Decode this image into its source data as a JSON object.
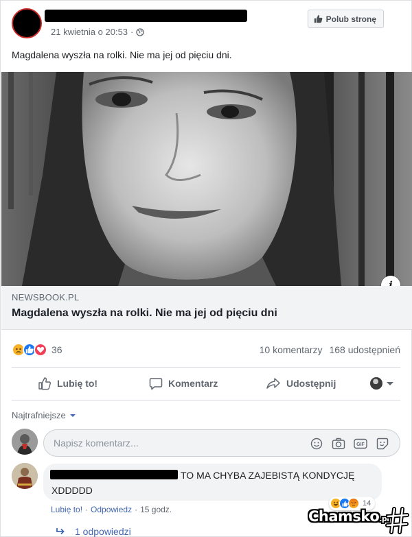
{
  "post": {
    "timestamp": "21 kwietnia o 20:53",
    "separator": "·",
    "privacy_icon": "globe-icon",
    "like_page_label": "Polub stronę",
    "text": "Magdalena wyszła na rolki. Nie ma jej od pięciu dni."
  },
  "link_preview": {
    "domain": "NEWSBOOK.PL",
    "title": "Magdalena wyszła na rolki. Nie ma jej od pięciu dni",
    "info_label": "i"
  },
  "engagement": {
    "reaction_icons": [
      "sad-icon",
      "like-icon",
      "love-icon"
    ],
    "reaction_count": "36",
    "comments": "10 komentarzy",
    "shares": "168 udostępnień"
  },
  "actions": {
    "like": "Lubię to!",
    "comment": "Komentarz",
    "share": "Udostępnij"
  },
  "comments_section": {
    "sort_label": "Najtrafniejsze",
    "input_placeholder": "Napisz komentarz...",
    "input_icons": [
      "emoji-icon",
      "camera-icon",
      "gif-icon",
      "sticker-icon"
    ]
  },
  "comment": {
    "text": "TO MA CHYBA ZAJEBISTĄ KONDYCJĘ XDDDDD",
    "reaction_icons": [
      "haha-icon",
      "like-icon",
      "angry-icon"
    ],
    "reaction_count": "14",
    "like_label": "Lubię to!",
    "reply_label": "Odpowiedz",
    "time": "15 godz.",
    "replies_label": "1 odpowiedzi"
  },
  "watermark": {
    "brand": "Chamsko",
    "suffix": ".pl"
  },
  "colors": {
    "facebook_blue": "#4267b2",
    "secondary_text": "#606770",
    "border": "#dddfe2",
    "love": "#f33e58",
    "like": "#1877f2",
    "sad": "#f7b125"
  }
}
